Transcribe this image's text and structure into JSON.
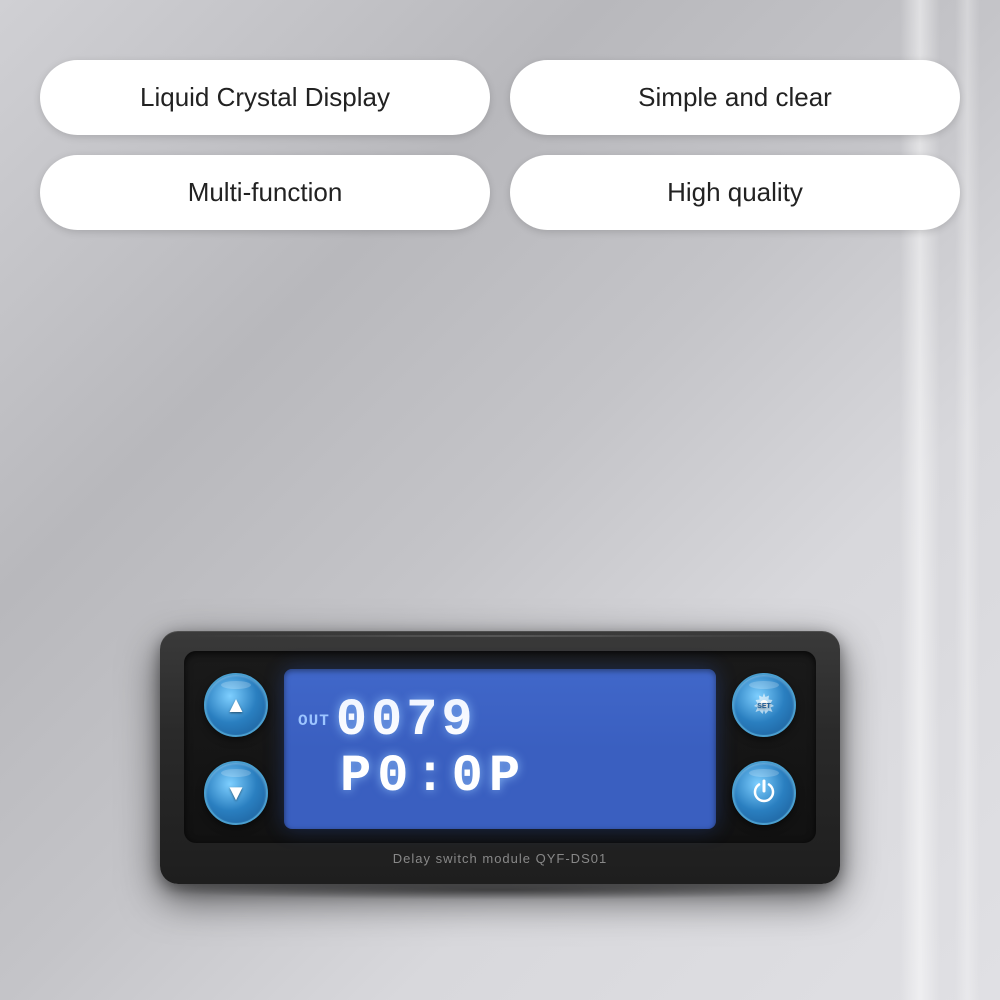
{
  "background": {
    "color": "#c8c8cc"
  },
  "features": [
    {
      "id": "lcd",
      "label": "Liquid Crystal Display"
    },
    {
      "id": "simple",
      "label": "Simple and clear"
    },
    {
      "id": "multi",
      "label": "Multi-function"
    },
    {
      "id": "quality",
      "label": "High quality"
    }
  ],
  "device": {
    "lcd": {
      "out_label": "OUT",
      "row1_digits": "0079",
      "row2_digits": "P0:0P"
    },
    "buttons": {
      "up_label": "▲",
      "down_label": "▼",
      "set_label": "⚙",
      "power_label": "⏻"
    },
    "model_label": "Delay switch module  QYF-DS01"
  }
}
